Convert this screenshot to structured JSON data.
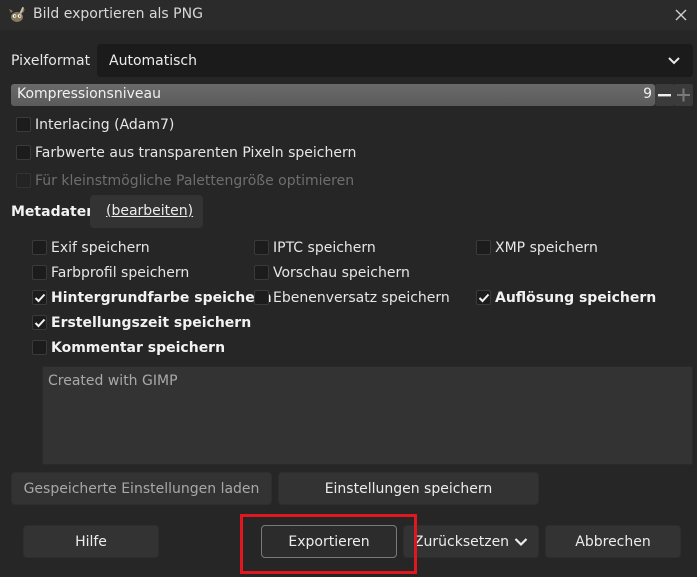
{
  "window": {
    "title": "Bild exportieren als PNG"
  },
  "pixelformat": {
    "label": "Pixelformat",
    "value": "Automatisch"
  },
  "compression": {
    "label": "Kompressionsniveau",
    "value": "9"
  },
  "options": {
    "interlacing": {
      "label": "Interlacing (Adam7)",
      "checked": false
    },
    "transparent": {
      "label": "Farbwerte aus transparenten Pixeln speichern",
      "checked": false
    },
    "palette": {
      "label": "Für kleinstmögliche Palettengröße optimieren",
      "checked": false,
      "disabled": true
    }
  },
  "metadata": {
    "label": "Metadaten",
    "edit_label": "(bearbeiten)",
    "exif": {
      "label": "Exif speichern",
      "checked": false
    },
    "iptc": {
      "label": "IPTC speichern",
      "checked": false
    },
    "xmp": {
      "label": "XMP speichern",
      "checked": false
    },
    "colorprofile": {
      "label": "Farbprofil speichern",
      "checked": false
    },
    "preview": {
      "label": "Vorschau speichern",
      "checked": false
    },
    "background": {
      "label": "Hintergrundfarbe speichern",
      "checked": true
    },
    "layeroffset": {
      "label": "Ebenenversatz speichern",
      "checked": false
    },
    "resolution": {
      "label": "Auflösung speichern",
      "checked": true
    },
    "creationtime": {
      "label": "Erstellungszeit speichern",
      "checked": true
    },
    "comment": {
      "label": "Kommentar speichern",
      "checked": false
    },
    "comment_text": "Created with GIMP"
  },
  "buttons": {
    "load_settings": "Gespeicherte Einstellungen laden",
    "save_settings": "Einstellungen speichern",
    "help": "Hilfe",
    "export": "Exportieren",
    "reset": "Zurücksetzen",
    "cancel": "Abbrechen"
  },
  "colors": {
    "highlight": "#e0171f",
    "background": "#262626"
  },
  "icons": {
    "app": "gimp-icon",
    "close": "close-icon",
    "dropdown": "chevron-down-icon"
  }
}
